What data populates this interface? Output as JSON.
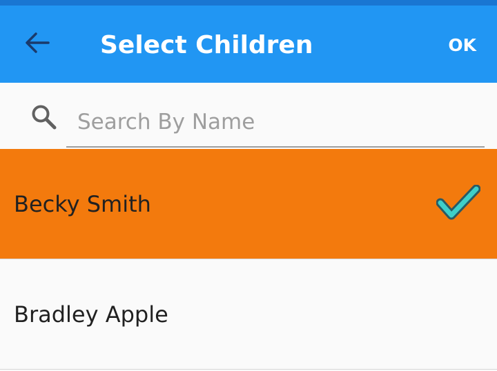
{
  "app_bar": {
    "title": "Select Children",
    "ok_label": "OK",
    "back_icon": "arrow-left-icon",
    "background": "#2196f3",
    "status_color": "#1976d2"
  },
  "search": {
    "placeholder": "Search By Name",
    "value": "",
    "icon": "search-icon"
  },
  "children": [
    {
      "name": "Becky Smith",
      "selected": true,
      "background": "#f37a0d",
      "check_icon": "check-icon",
      "check_color": "#3ecfc9"
    },
    {
      "name": "Bradley Apple",
      "selected": false,
      "background": "#fafafa"
    }
  ]
}
